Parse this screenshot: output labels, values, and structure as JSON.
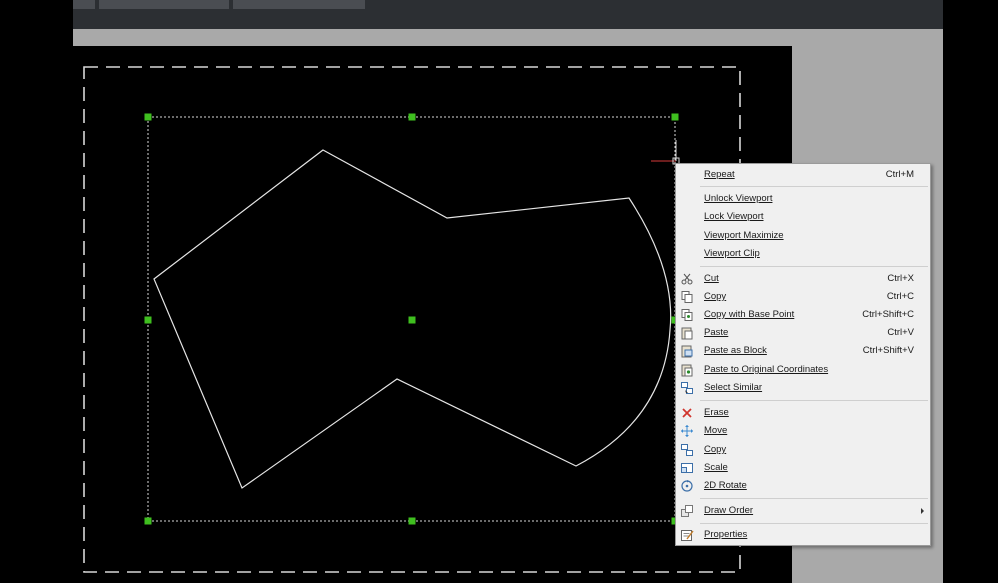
{
  "colors": {
    "canvas": "#000000",
    "grips": "#3fbf1f",
    "menu_bg": "#f0f0f0",
    "shape": "#e6e6e6"
  },
  "context_menu": {
    "items": [
      {
        "label": "Repeat",
        "shortcut": "Ctrl+M",
        "icon": ""
      },
      {
        "label": "Unlock Viewport",
        "shortcut": "",
        "icon": ""
      },
      {
        "label": "Lock Viewport",
        "shortcut": "",
        "icon": ""
      },
      {
        "label": "Viewport Maximize",
        "shortcut": "",
        "icon": ""
      },
      {
        "label": "Viewport Clip",
        "shortcut": "",
        "icon": ""
      },
      {
        "label": "Cut",
        "shortcut": "Ctrl+X",
        "icon": "scissors-icon"
      },
      {
        "label": "Copy",
        "shortcut": "Ctrl+C",
        "icon": "copy-icon"
      },
      {
        "label": "Copy with Base Point",
        "shortcut": "Ctrl+Shift+C",
        "icon": "copy-base-point-icon"
      },
      {
        "label": "Paste",
        "shortcut": "Ctrl+V",
        "icon": "paste-icon"
      },
      {
        "label": "Paste as Block",
        "shortcut": "Ctrl+Shift+V",
        "icon": "paste-block-icon"
      },
      {
        "label": "Paste to Original Coordinates",
        "shortcut": "",
        "icon": "paste-original-icon"
      },
      {
        "label": "Select Similar",
        "shortcut": "",
        "icon": "select-similar-icon"
      },
      {
        "label": "Erase",
        "shortcut": "",
        "icon": "erase-icon"
      },
      {
        "label": "Move",
        "shortcut": "",
        "icon": "move-icon"
      },
      {
        "label": "Copy",
        "shortcut": "",
        "icon": "copy-objects-icon"
      },
      {
        "label": "Scale",
        "shortcut": "",
        "icon": "scale-icon"
      },
      {
        "label": "2D Rotate",
        "shortcut": "",
        "icon": "rotate-icon"
      },
      {
        "label": "Draw Order",
        "shortcut": "",
        "icon": "draw-order-icon"
      },
      {
        "label": "Properties",
        "shortcut": "",
        "icon": "properties-icon"
      }
    ]
  }
}
